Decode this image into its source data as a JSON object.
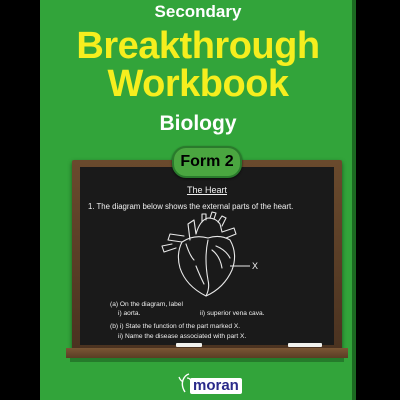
{
  "cover": {
    "series": "Secondary",
    "title_line1": "Breakthrough",
    "title_line2": "Workbook",
    "subject": "Biology",
    "form_badge": "Form 2",
    "publisher": "moran"
  },
  "chalkboard": {
    "heading": "The Heart",
    "question": "1.  The diagram below shows the external parts of the heart.",
    "diagram_pointer_label": "X",
    "part_a_intro": "(a)  On the diagram, label",
    "part_a_i": "i)   aorta.",
    "part_a_ii": "ii)  superior vena cava.",
    "part_b_i": "(b)  i)   State the function of the part marked X.",
    "part_b_ii": "ii)  Name the disease associated with part X."
  },
  "colors": {
    "cover_green": "#32a43a",
    "title_yellow": "#f6ee1e",
    "board_black": "#1a1a1a",
    "frame_brown": "#5a3d24"
  }
}
